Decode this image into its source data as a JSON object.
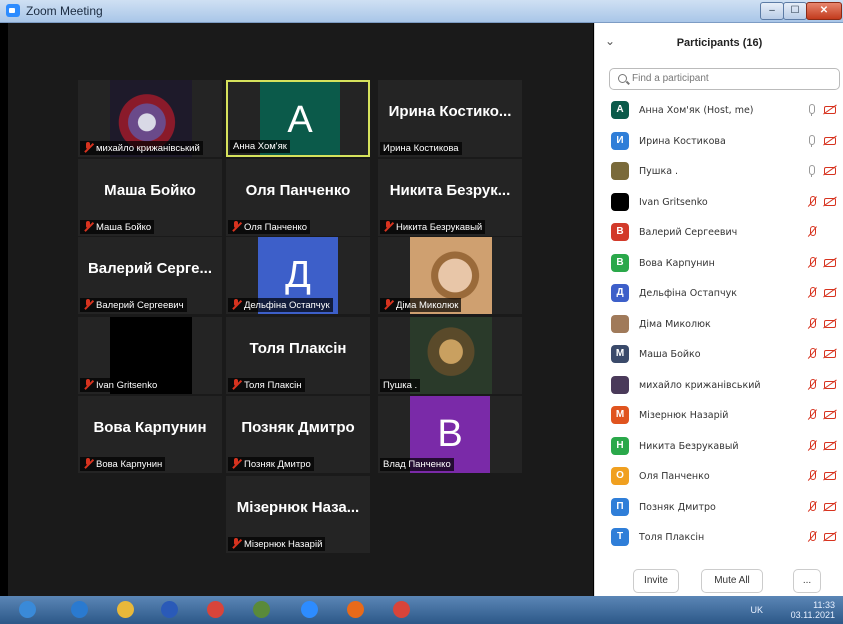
{
  "window": {
    "title": "Zoom Meeting",
    "min": "‒",
    "max": "☐",
    "close": "✕"
  },
  "tiles": [
    {
      "id": "t1",
      "name": "михайло крижанівський",
      "muted": true,
      "type": "photo",
      "photo": "dark"
    },
    {
      "id": "t2",
      "name": "Анна Хом'як",
      "muted": false,
      "type": "letter",
      "letter": "A",
      "color": "#0b5a4a",
      "active": true
    },
    {
      "id": "t3",
      "name": "Ирина Костикова",
      "muted": false,
      "type": "text",
      "big": "Ирина Костико..."
    },
    {
      "id": "t4",
      "name": "Маша Бойко",
      "muted": true,
      "type": "text",
      "big": "Маша Бойко"
    },
    {
      "id": "t5",
      "name": "Оля Панченко",
      "muted": true,
      "type": "text",
      "big": "Оля Панченко"
    },
    {
      "id": "t6",
      "name": "Никита Безрукавый",
      "muted": true,
      "type": "text",
      "big": "Никита Безрук..."
    },
    {
      "id": "t7",
      "name": "Валерий Сергеевич",
      "muted": true,
      "type": "text",
      "big": "Валерий Серге..."
    },
    {
      "id": "t8",
      "name": "Дельфіна Остапчук",
      "muted": true,
      "type": "letter",
      "letter": "Д",
      "color": "#3d5fc9"
    },
    {
      "id": "t9",
      "name": "Діма Миколюк",
      "muted": true,
      "type": "photo",
      "photo": "boy"
    },
    {
      "id": "t10",
      "name": "Ivan Gritsenko",
      "muted": true,
      "type": "photo",
      "photo": "black"
    },
    {
      "id": "t11",
      "name": "Толя Плаксін",
      "muted": true,
      "type": "text",
      "big": "Толя Плаксін"
    },
    {
      "id": "t12",
      "name": "Пушка .",
      "muted": false,
      "type": "photo",
      "photo": "lisa"
    },
    {
      "id": "t13",
      "name": "Вова Карпунин",
      "muted": true,
      "type": "text",
      "big": "Вова Карпунин"
    },
    {
      "id": "t14",
      "name": "Позняк Дмитро",
      "muted": true,
      "type": "text",
      "big": "Позняк Дмитро"
    },
    {
      "id": "t15",
      "name": "Влад Панченко",
      "muted": false,
      "type": "letter",
      "letter": "B",
      "color": "#7a2aa8"
    },
    {
      "id": "t16",
      "name": "Мізернюк Назарій",
      "muted": true,
      "type": "text",
      "big": "Мізернюк Наза..."
    }
  ],
  "panel": {
    "title": "Participants (16)",
    "collapse": "⌄",
    "search_placeholder": "Find a participant",
    "invite": "Invite",
    "mute_all": "Mute All",
    "more": "..."
  },
  "participants": [
    {
      "name": "Анна Хом'як (Host, me)",
      "av": "A",
      "color": "#0b5a4a",
      "mic": "on",
      "cam": "off"
    },
    {
      "name": "Ирина Костикова",
      "av": "И",
      "color": "#2f7ed8",
      "mic": "on",
      "cam": "off"
    },
    {
      "name": "Пушка .",
      "av": "",
      "color": "#7a6a3a",
      "mic": "on",
      "cam": "off"
    },
    {
      "name": "Ivan Gritsenko",
      "av": "",
      "color": "#000000",
      "mic": "off",
      "cam": "off"
    },
    {
      "name": "Валерий Сергеевич",
      "av": "В",
      "color": "#d23a2a",
      "mic": "off",
      "cam": "none"
    },
    {
      "name": "Вова Карпунин",
      "av": "В",
      "color": "#2aa84a",
      "mic": "off",
      "cam": "off"
    },
    {
      "name": "Дельфіна Остапчук",
      "av": "Д",
      "color": "#3d5fc9",
      "mic": "off",
      "cam": "off"
    },
    {
      "name": "Діма Миколюк",
      "av": "",
      "color": "#a07a5a",
      "mic": "off",
      "cam": "off"
    },
    {
      "name": "Маша Бойко",
      "av": "М",
      "color": "#3a4a6a",
      "mic": "off",
      "cam": "off"
    },
    {
      "name": "михайло крижанівський",
      "av": "",
      "color": "#4a3a5a",
      "mic": "off",
      "cam": "off"
    },
    {
      "name": "Мізернюк Назарій",
      "av": "М",
      "color": "#e0541f",
      "mic": "off",
      "cam": "off"
    },
    {
      "name": "Никита Безрукавый",
      "av": "Н",
      "color": "#2aa84a",
      "mic": "off",
      "cam": "off"
    },
    {
      "name": "Оля Панченко",
      "av": "О",
      "color": "#f0a020",
      "mic": "off",
      "cam": "off"
    },
    {
      "name": "Позняк Дмитро",
      "av": "П",
      "color": "#2f7ed8",
      "mic": "off",
      "cam": "off"
    },
    {
      "name": "Толя Плаксін",
      "av": "Т",
      "color": "#2f7ed8",
      "mic": "off",
      "cam": "off"
    }
  ],
  "taskbar": {
    "apps": [
      "start-icon",
      "ie-icon",
      "explorer-icon",
      "word-icon",
      "chrome-icon",
      "calendar-icon",
      "zoom-icon",
      "media-icon",
      "chrome-alt-icon"
    ],
    "lang": "UK",
    "time": "11:33",
    "date": "03.11.2021"
  }
}
